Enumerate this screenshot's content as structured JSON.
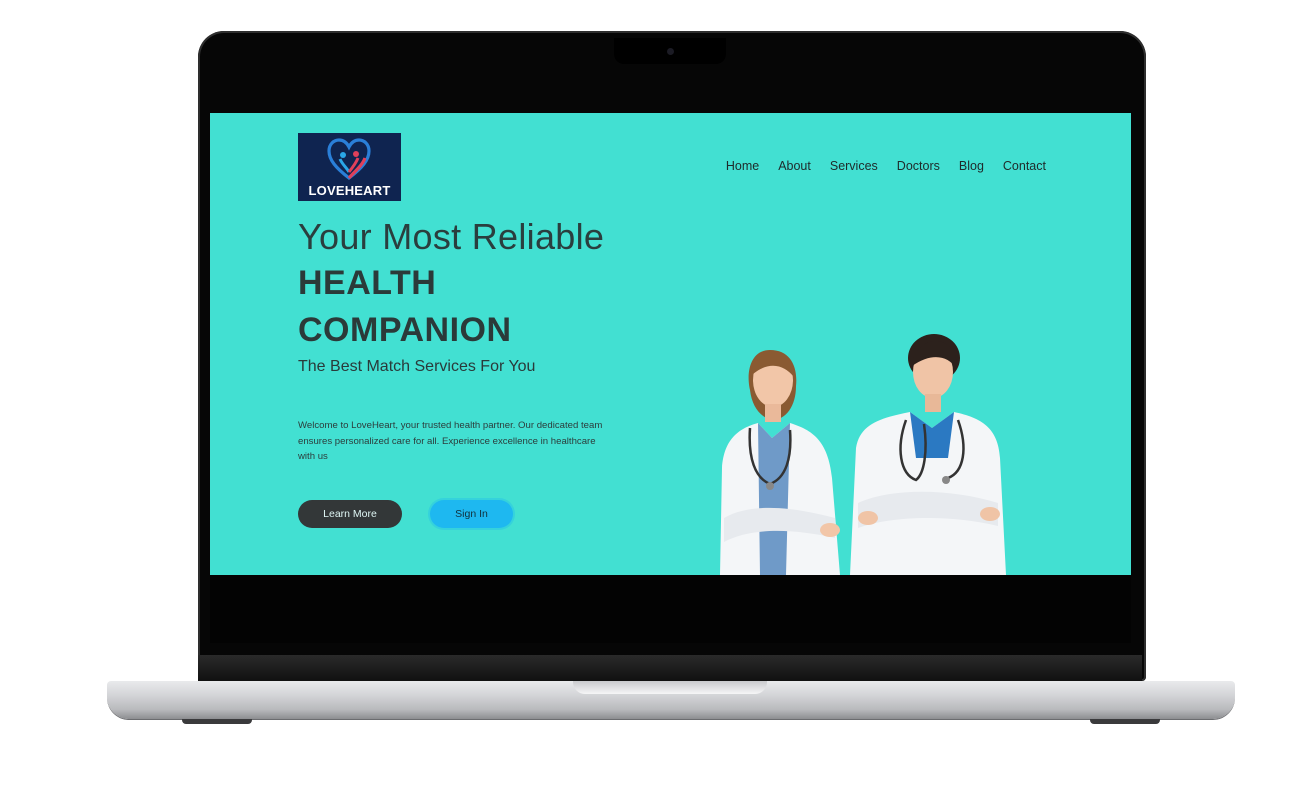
{
  "brand": {
    "logo_text": "LOVEHEART",
    "logo_bg": "#0f2450"
  },
  "nav": {
    "items": [
      {
        "label": "Home"
      },
      {
        "label": "About"
      },
      {
        "label": "Services"
      },
      {
        "label": "Doctors"
      },
      {
        "label": "Blog"
      },
      {
        "label": "Contact"
      }
    ]
  },
  "hero": {
    "title_line1": "Your Most Reliable",
    "title_line2": "HEALTH",
    "title_line3": "COMPANION",
    "subtitle": "The Best Match Services For You",
    "description": "Welcome to LoveHeart, your trusted health partner. Our dedicated team ensures personalized care for all. Experience excellence in healthcare with us",
    "learn_more_label": "Learn More",
    "sign_in_label": "Sign In"
  },
  "image": {
    "semantic": "two-female-doctors-photo"
  },
  "colors": {
    "background": "#42e0d2",
    "primary_button": "#333738",
    "secondary_button": "#1eb8f0",
    "heading": "#2a3e3e"
  }
}
